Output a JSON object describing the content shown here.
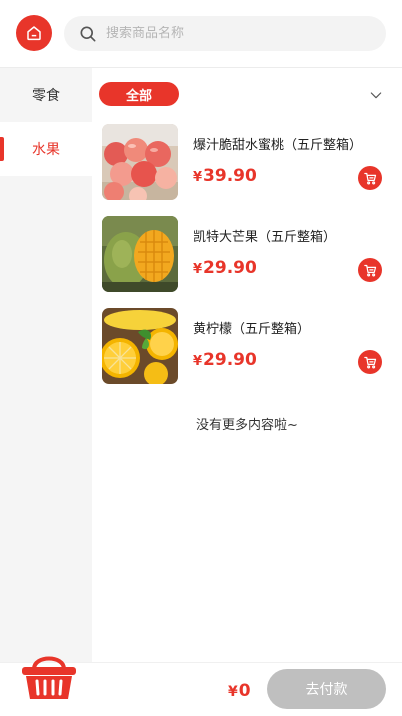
{
  "header": {
    "home_icon": "home-icon",
    "search": {
      "icon": "search-icon",
      "placeholder": "搜索商品名称",
      "value": ""
    }
  },
  "sidebar": {
    "items": [
      {
        "label": "零食",
        "active": false
      },
      {
        "label": "水果",
        "active": true
      }
    ]
  },
  "filter": {
    "selected": "全部",
    "dropdown_icon": "chevron-down-icon"
  },
  "products": [
    {
      "name": "爆汁脆甜水蜜桃（五斤整箱）",
      "currency": "¥",
      "price": "39.90",
      "image": "peach-image",
      "cart_icon": "cart-icon"
    },
    {
      "name": "凯特大芒果（五斤整箱）",
      "currency": "¥",
      "price": "29.90",
      "image": "mango-image",
      "cart_icon": "cart-icon"
    },
    {
      "name": "黄柠檬（五斤整箱）",
      "currency": "¥",
      "price": "29.90",
      "image": "lemon-image",
      "cart_icon": "cart-icon"
    }
  ],
  "list_end_text": "没有更多内容啦~",
  "bottom_bar": {
    "basket_icon": "shopping-basket-icon",
    "currency": "¥",
    "total": "0",
    "pay_label": "去付款"
  },
  "colors": {
    "accent": "#e8352a",
    "disabled_button": "#bfbfbf",
    "sidebar_bg": "#f5f5f5"
  }
}
